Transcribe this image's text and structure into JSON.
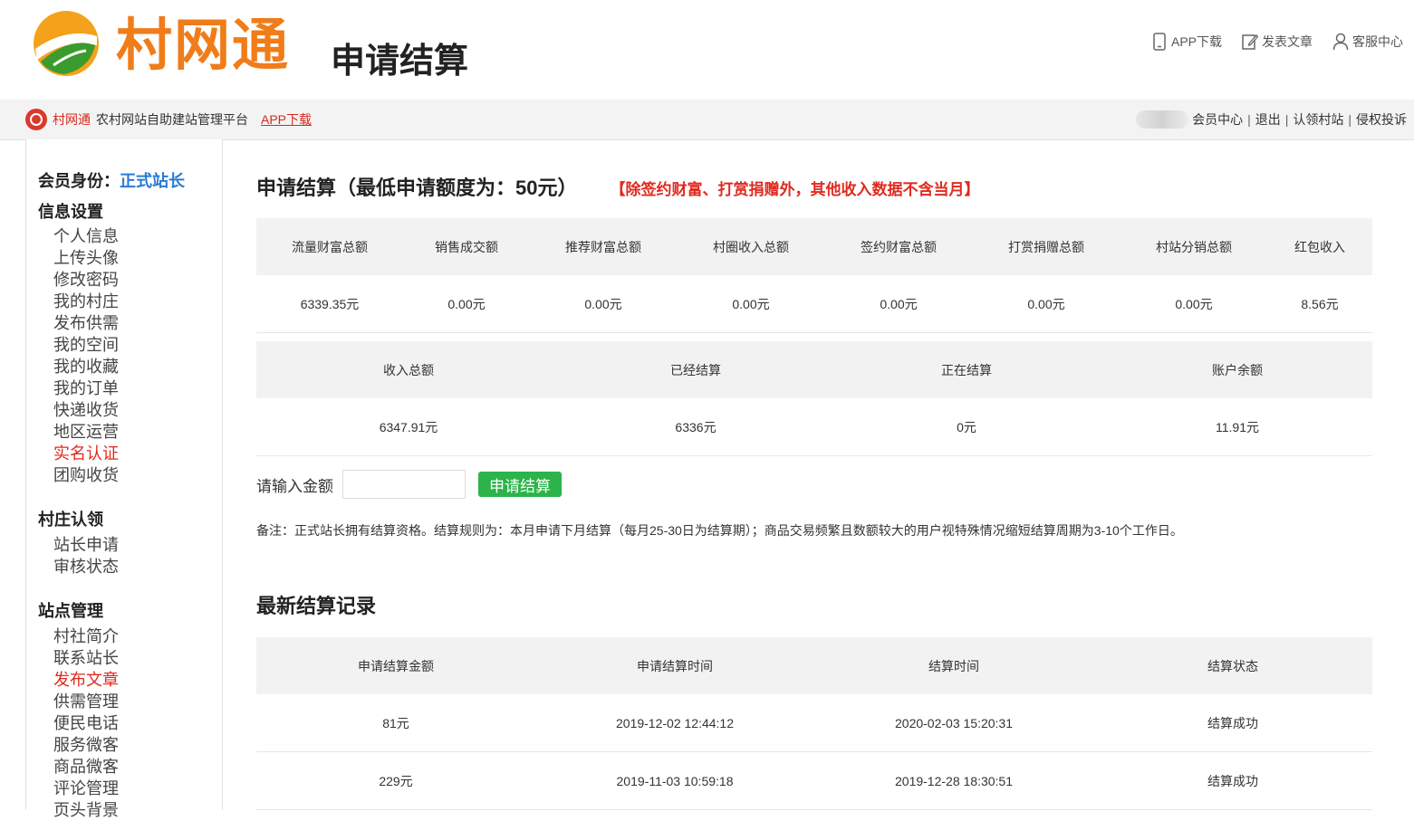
{
  "header": {
    "brand": "村网通",
    "page_title": "申请结算",
    "links": [
      {
        "label": "APP下载",
        "icon": "phone-icon"
      },
      {
        "label": "发表文章",
        "icon": "edit-icon"
      },
      {
        "label": "客服中心",
        "icon": "user-icon"
      }
    ]
  },
  "bar": {
    "brand": "村网通",
    "description": "农村网站自助建站管理平台",
    "app_link": "APP下载",
    "links": [
      "会员中心",
      "退出",
      "认领村站",
      "侵权投诉"
    ],
    "separator": "|"
  },
  "sidebar": {
    "member_label": "会员身份：",
    "member_role": "正式站长",
    "groups": [
      {
        "title": "信息设置",
        "items": [
          {
            "label": "个人信息",
            "active": false
          },
          {
            "label": "上传头像",
            "active": false
          },
          {
            "label": "修改密码",
            "active": false
          },
          {
            "label": "我的村庄",
            "active": false
          },
          {
            "label": "发布供需",
            "active": false
          },
          {
            "label": "我的空间",
            "active": false
          },
          {
            "label": "我的收藏",
            "active": false
          },
          {
            "label": "我的订单",
            "active": false
          },
          {
            "label": "快递收货",
            "active": false
          },
          {
            "label": "地区运营",
            "active": false
          },
          {
            "label": "实名认证",
            "active": true
          },
          {
            "label": "团购收货",
            "active": false
          }
        ]
      },
      {
        "title": "村庄认领",
        "items": [
          {
            "label": "站长申请",
            "active": false
          },
          {
            "label": "审核状态",
            "active": false
          }
        ]
      },
      {
        "title": "站点管理",
        "items": [
          {
            "label": "村社简介",
            "active": false
          },
          {
            "label": "联系站长",
            "active": false
          },
          {
            "label": "发布文章",
            "active": true
          },
          {
            "label": "供需管理",
            "active": false
          },
          {
            "label": "便民电话",
            "active": false
          },
          {
            "label": "服务微客",
            "active": false
          },
          {
            "label": "商品微客",
            "active": false
          },
          {
            "label": "评论管理",
            "active": false
          },
          {
            "label": "页头背景",
            "active": false
          }
        ]
      }
    ]
  },
  "main": {
    "title": "申请结算（最低申请额度为：50元）",
    "warning": "【除签约财富、打赏捐赠外，其他收入数据不含当月】",
    "income_table": {
      "headers": [
        "流量财富总额",
        "销售成交额",
        "推荐财富总额",
        "村圈收入总额",
        "签约财富总额",
        "打赏捐赠总额",
        "村站分销总额",
        "红包收入"
      ],
      "values": [
        "6339.35元",
        "0.00元",
        "0.00元",
        "0.00元",
        "0.00元",
        "0.00元",
        "0.00元",
        "8.56元"
      ]
    },
    "summary_table": {
      "headers": [
        "收入总额",
        "已经结算",
        "正在结算",
        "账户余额"
      ],
      "values": [
        "6347.91元",
        "6336元",
        "0元",
        "11.91元"
      ]
    },
    "amount_label": "请输入金额",
    "amount_value": "",
    "apply_button": "申请结算",
    "note": "备注：正式站长拥有结算资格。结算规则为：本月申请下月结算（每月25-30日为结算期）；商品交易频繁且数额较大的用户视特殊情况缩短结算周期为3-10个工作日。",
    "records_title": "最新结算记录",
    "records_table": {
      "headers": [
        "申请结算金额",
        "申请结算时间",
        "结算时间",
        "结算状态"
      ],
      "rows": [
        [
          "81元",
          "2019-12-02 12:44:12",
          "2020-02-03 15:20:31",
          "结算成功"
        ],
        [
          "229元",
          "2019-11-03 10:59:18",
          "2019-12-28 18:30:51",
          "结算成功"
        ]
      ]
    }
  },
  "colors": {
    "brand_orange": "#f07c1a",
    "accent_red": "#e02a1f",
    "role_blue": "#2a7ad5",
    "button_green": "#2cb34a"
  }
}
